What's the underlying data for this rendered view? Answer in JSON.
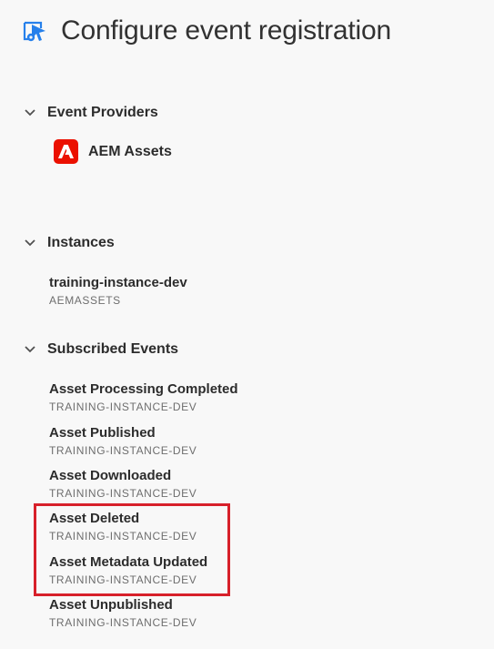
{
  "header": {
    "title": "Configure event registration",
    "icon": "configure-events-icon"
  },
  "sections": {
    "providers": {
      "title": "Event Providers",
      "items": [
        {
          "label": "AEM Assets",
          "icon": "adobe-logo-icon",
          "badge_color": "#eb1000"
        }
      ]
    },
    "instances": {
      "title": "Instances",
      "items": [
        {
          "name": "training-instance-dev",
          "sub": "AEMASSETS"
        }
      ]
    },
    "subscribed": {
      "title": "Subscribed Events",
      "items": [
        {
          "name": "Asset Processing Completed",
          "sub": "TRAINING-INSTANCE-DEV"
        },
        {
          "name": "Asset Published",
          "sub": "TRAINING-INSTANCE-DEV"
        },
        {
          "name": "Asset Downloaded",
          "sub": "TRAINING-INSTANCE-DEV"
        },
        {
          "name": "Asset Deleted",
          "sub": "TRAINING-INSTANCE-DEV"
        },
        {
          "name": "Asset Metadata Updated",
          "sub": "TRAINING-INSTANCE-DEV"
        },
        {
          "name": "Asset Unpublished",
          "sub": "TRAINING-INSTANCE-DEV"
        }
      ]
    }
  },
  "colors": {
    "accent_blue": "#2680eb",
    "highlight_red": "#d7202a",
    "adobe_red": "#eb1000"
  }
}
